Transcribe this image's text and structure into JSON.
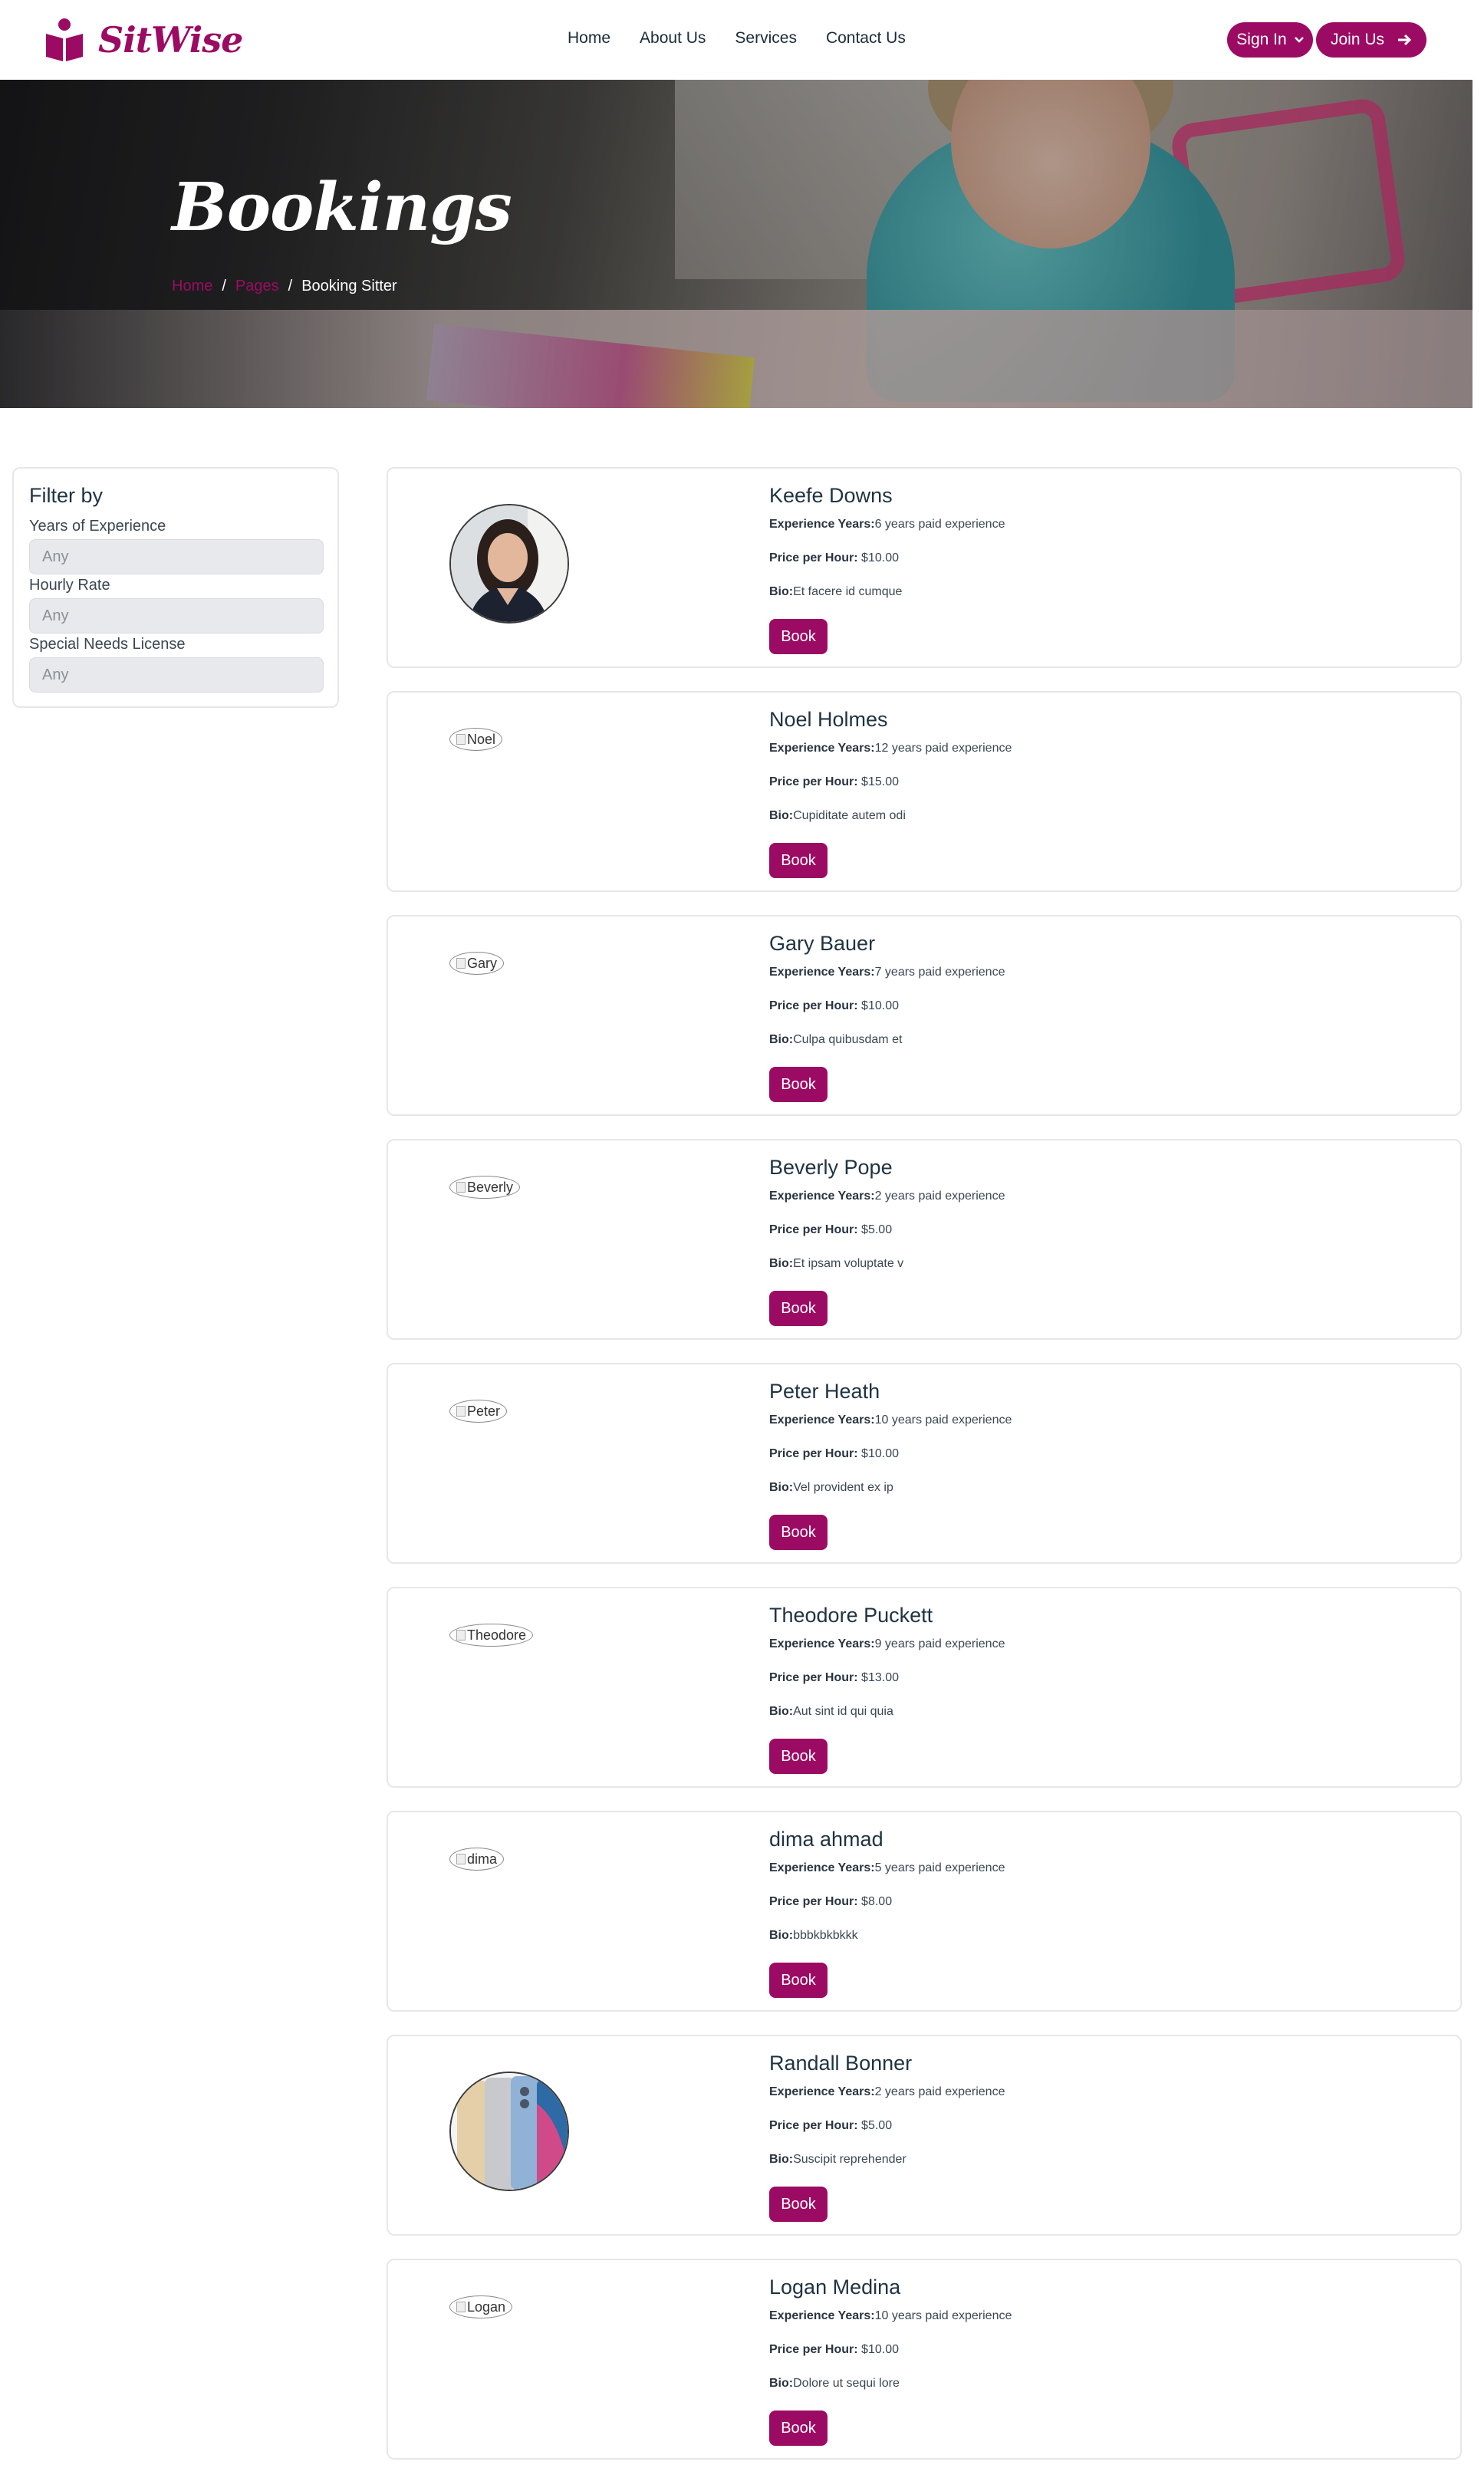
{
  "brand": {
    "name": "SitWise",
    "accent": "#9c0b63"
  },
  "nav": {
    "items": [
      "Home",
      "About Us",
      "Services",
      "Contact Us"
    ]
  },
  "auth": {
    "sign_in": "Sign In",
    "join": "Join Us"
  },
  "hero": {
    "title": "Bookings",
    "breadcrumb": {
      "home": "Home",
      "sep1": "/",
      "pages": "Pages",
      "sep2": "/",
      "current": "Booking Sitter"
    }
  },
  "filter": {
    "title": "Filter by",
    "fields": [
      {
        "label": "Years of Experience",
        "value": "Any"
      },
      {
        "label": "Hourly Rate",
        "value": "Any"
      },
      {
        "label": "Special Needs License",
        "value": "Any"
      }
    ]
  },
  "labels": {
    "experience": "Experience Years:",
    "price": "Price per Hour:",
    "bio": "Bio:",
    "book": "Book"
  },
  "sitters": [
    {
      "name": "Keefe Downs",
      "experience": "6 years paid experience",
      "price": "$10.00",
      "bio": "Et facere id cumque",
      "image": "woman-photo",
      "alt": ""
    },
    {
      "name": "Noel Holmes",
      "experience": "12 years paid experience",
      "price": "$15.00",
      "bio": "Cupiditate autem odi",
      "image": "broken",
      "alt": "Noel"
    },
    {
      "name": "Gary Bauer",
      "experience": "7 years paid experience",
      "price": "$10.00",
      "bio": "Culpa quibusdam et",
      "image": "broken",
      "alt": "Gary"
    },
    {
      "name": "Beverly Pope",
      "experience": "2 years paid experience",
      "price": "$5.00",
      "bio": "Et ipsam voluptate v",
      "image": "broken",
      "alt": "Beverly"
    },
    {
      "name": "Peter Heath",
      "experience": "10 years paid experience",
      "price": "$10.00",
      "bio": "Vel provident ex ip",
      "image": "broken",
      "alt": "Peter"
    },
    {
      "name": "Theodore Puckett",
      "experience": "9 years paid experience",
      "price": "$13.00",
      "bio": "Aut sint id qui quia",
      "image": "broken",
      "alt": "Theodore"
    },
    {
      "name": "dima ahmad",
      "experience": "5 years paid experience",
      "price": "$8.00",
      "bio": "bbbkbkbkkk",
      "image": "broken",
      "alt": "dima"
    },
    {
      "name": "Randall Bonner",
      "experience": "2 years paid experience",
      "price": "$5.00",
      "bio": "Suscipit reprehender",
      "image": "phone-photo",
      "alt": ""
    },
    {
      "name": "Logan Medina",
      "experience": "10 years paid experience",
      "price": "$10.00",
      "bio": "Dolore ut sequi lore",
      "image": "broken",
      "alt": "Logan"
    }
  ]
}
